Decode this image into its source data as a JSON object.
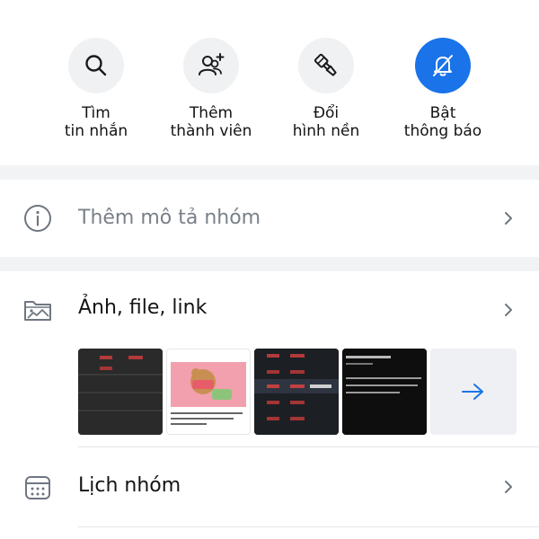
{
  "actions": [
    {
      "line1": "Tìm",
      "line2": "tin nhắn",
      "icon": "search-icon"
    },
    {
      "line1": "Thêm",
      "line2": "thành viên",
      "icon": "add-member-icon"
    },
    {
      "line1": "Đổi",
      "line2": "hình nền",
      "icon": "paint-brush-icon"
    },
    {
      "line1": "Bật",
      "line2": "thông báo",
      "icon": "bell-off-icon"
    }
  ],
  "rows": {
    "description": {
      "label": "Thêm mô tả nhóm",
      "icon": "info-icon"
    },
    "media": {
      "label": "Ảnh, file, link",
      "icon": "photo-folder-icon"
    },
    "calendar": {
      "label": "Lịch nhóm",
      "icon": "calendar-icon"
    }
  },
  "colors": {
    "accent": "#1a73e8",
    "icon_bg": "#f0f1f3",
    "separator": "#f2f3f5",
    "muted_text": "#7a8089"
  }
}
